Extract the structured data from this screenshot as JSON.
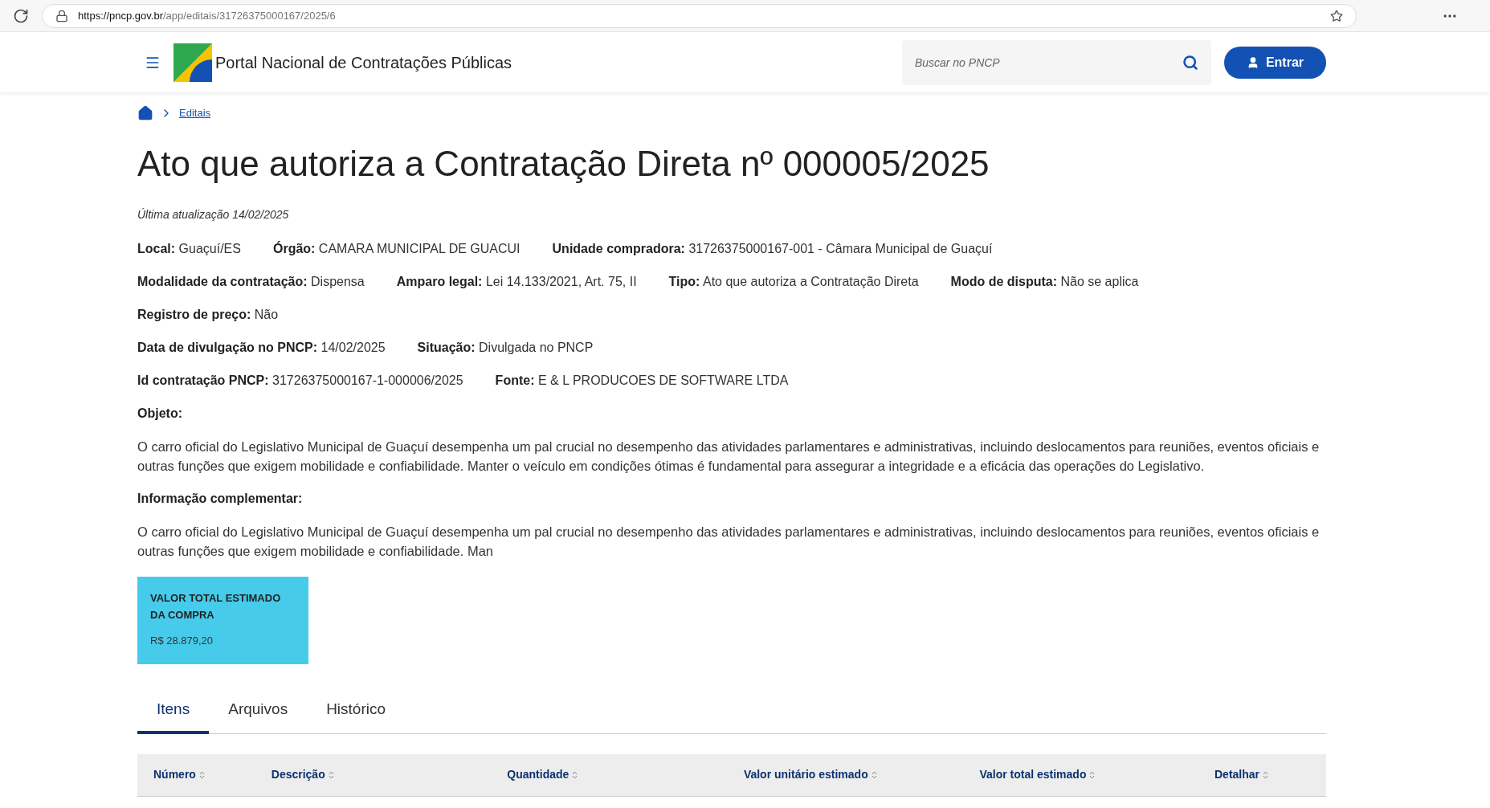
{
  "browser": {
    "url_host": "https://pncp.gov.br",
    "url_path": "/app/editais/31726375000167/2025/6"
  },
  "header": {
    "title": "Portal Nacional de Contratações Públicas",
    "search": {
      "placeholder": "Buscar no PNCP"
    },
    "login_button": "Entrar"
  },
  "breadcrumb": [
    "Editais"
  ],
  "page": {
    "title": "Ato que autoriza a Contratação Direta nº 000005/2025",
    "updated": "Última atualização 14/02/2025"
  },
  "info_rows": [
    [
      {
        "label": "Local:",
        "value": "Guaçuí/ES"
      },
      {
        "label": "Órgão:",
        "value": "CAMARA MUNICIPAL DE GUACUI"
      },
      {
        "label": "Unidade compradora:",
        "value": "31726375000167-001 - Câmara Municipal de Guaçuí"
      }
    ],
    [
      {
        "label": "Modalidade da contratação:",
        "value": "Dispensa"
      },
      {
        "label": "Amparo legal:",
        "value": "Lei 14.133/2021, Art. 75, II"
      },
      {
        "label": "Tipo:",
        "value": "Ato que autoriza a Contratação Direta"
      },
      {
        "label": "Modo de disputa:",
        "value": "Não se aplica"
      }
    ],
    [
      {
        "label": "Registro de preço:",
        "value": "Não"
      }
    ],
    [
      {
        "label": "Data de divulgação no PNCP:",
        "value": "14/02/2025"
      },
      {
        "label": "Situação:",
        "value": "Divulgada no PNCP"
      }
    ],
    [
      {
        "label": "Id contratação PNCP:",
        "value": "31726375000167-1-000006/2025"
      },
      {
        "label": "Fonte:",
        "value": "E & L PRODUCOES DE SOFTWARE LTDA"
      }
    ]
  ],
  "sections": [
    {
      "label": "Objeto:",
      "text": "O carro oficial do Legislativo Municipal de Guaçuí desempenha um pal crucial no desempenho das atividades parlamentares e administrativas, incluindo deslocamentos para reuniões, eventos oficiais e outras funções que exigem mobilidade e confiabilidade. Manter o veículo em condições ótimas é fundamental para assegurar a integridade e a eficácia das operações do Legislativo."
    },
    {
      "label": "Informação complementar:",
      "text": "O carro oficial do Legislativo Municipal de Guaçuí desempenha um pal crucial no desempenho das atividades parlamentares e administrativas, incluindo deslocamentos para reuniões, eventos oficiais e outras funções que exigem mobilidade e confiabilidade. Man"
    }
  ],
  "value_card": {
    "label": "VALOR TOTAL ESTIMADO DA COMPRA",
    "value": "R$ 28.879,20"
  },
  "tabs": [
    {
      "label": "Itens",
      "selected": true
    },
    {
      "label": "Arquivos",
      "selected": false
    },
    {
      "label": "Histórico",
      "selected": false
    }
  ],
  "table": {
    "columns": [
      "Número",
      "Descrição",
      "Quantidade",
      "Valor unitário estimado",
      "Valor total estimado",
      "Detalhar"
    ]
  }
}
